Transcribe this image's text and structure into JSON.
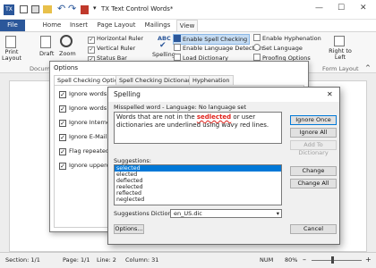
{
  "window": {
    "title": "TX Text Control Words*",
    "minimize": "—",
    "maximize": "☐",
    "close": "✕"
  },
  "tabs": [
    "File",
    "Home",
    "Insert",
    "Page Layout",
    "Mailings",
    "View"
  ],
  "ribbon": {
    "print_layout": "Print Layout",
    "draft": "Draft",
    "zoom": "Zoom",
    "horizontal_ruler": "Horizontal Ruler",
    "vertical_ruler": "Vertical Ruler",
    "status_bar": "Status Bar",
    "spelling": "Spelling",
    "abc": "ABC",
    "enable_spell_checking": "Enable Spell Checking",
    "enable_language_detection": "Enable Language Detection",
    "load_dictionary": "Load Dictionary",
    "enable_hyphenation": "Enable Hyphenation",
    "set_language": "Set Language",
    "proofing_options": "Proofing Options",
    "right_to_left": "Right to Left",
    "group_document": "Docume",
    "group_form_layout": "Form Layout"
  },
  "options_dialog": {
    "title": "Options",
    "tabs": [
      "Spell Checking Options",
      "Spell Checking Dictionaries",
      "Hyphenation"
    ],
    "checks": [
      "Ignore words in UP",
      "Ignore words that c",
      "Ignore Internet add",
      "Ignore E-Mail addre",
      "Flag repeated word",
      "Ignore uppercase a"
    ]
  },
  "spelling_dialog": {
    "title": "Spelling",
    "close": "✕",
    "misspelled_label": "Misspelled word - Language: No language set",
    "text_before": "Words that are not in the ",
    "misspelled_word": "sedlected",
    "text_after": " or user dictionaries are underlined using wavy red lines.",
    "ignore_once": "Ignore Once",
    "ignore_all": "Ignore All",
    "add_to_dictionary": "Add To Dictionary",
    "suggestions_label": "Suggestions:",
    "suggestions": [
      "selected",
      "elected",
      "deflected",
      "reelected",
      "reflected",
      "neglected"
    ],
    "change": "Change",
    "change_all": "Change All",
    "dictionary_label": "Suggestions Dictionary:",
    "dictionary_value": "en_US.dic",
    "options_button": "Options...",
    "cancel_button": "Cancel"
  },
  "status": {
    "section": "Section: 1/1",
    "page": "Page: 1/1",
    "line": "Line: 2",
    "column": "Column: 31",
    "num": "NUM",
    "zoom": "80%"
  },
  "colors": {
    "accent": "#2b579a",
    "misspelled": "#e0211a",
    "selection": "#0078d7"
  }
}
